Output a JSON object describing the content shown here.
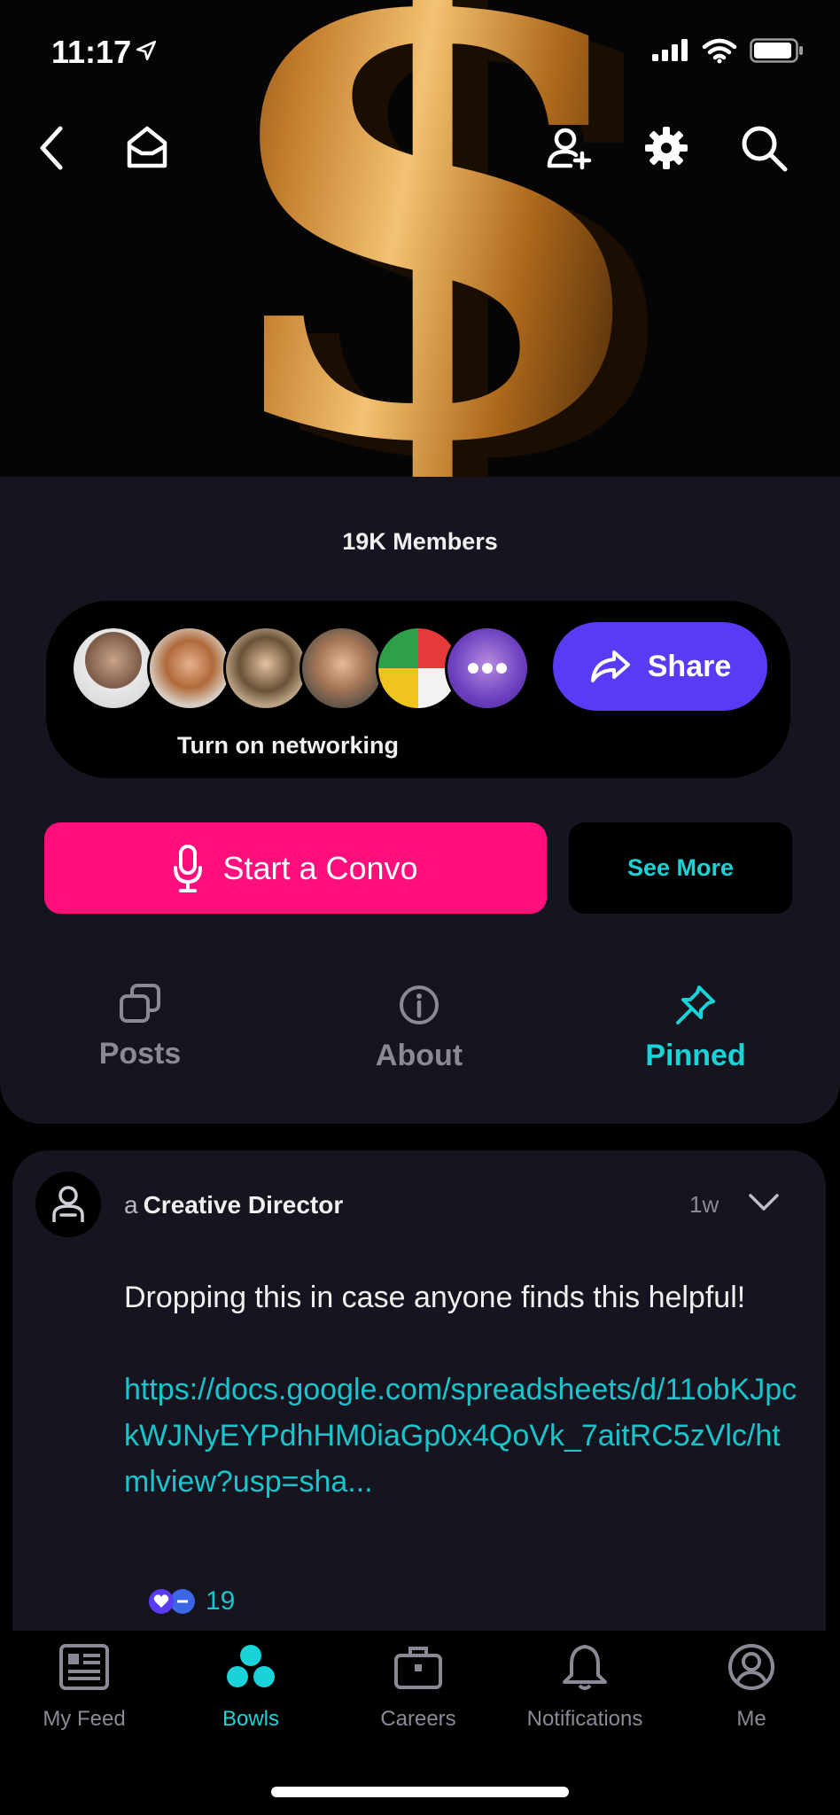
{
  "status_bar": {
    "time": "11:17"
  },
  "group": {
    "members": "19K Members",
    "networking_label": "Turn on networking",
    "share_label": "Share",
    "start_convo_label": "Start a Convo",
    "see_more_label": "See More"
  },
  "tabs": [
    {
      "label": "Posts",
      "icon": "copy-icon",
      "active": false
    },
    {
      "label": "About",
      "icon": "info-icon",
      "active": false
    },
    {
      "label": "Pinned",
      "icon": "pin-icon",
      "active": true
    }
  ],
  "post": {
    "author_prefix": "a",
    "author_role": "Creative Director",
    "time": "1w",
    "text": "Dropping this in case anyone finds this helpful!",
    "link": "https://docs.google.com/spreadsheets/d/11obKJpckWJNyEYPdhHM0iaGp0x4QoVk_7aitRC5zVlc/htmlview?usp=sha...",
    "reaction_count": "19"
  },
  "bottom_nav": [
    {
      "label": "My Feed",
      "icon": "feed-icon",
      "active": false
    },
    {
      "label": "Bowls",
      "icon": "bowls-icon",
      "active": true
    },
    {
      "label": "Careers",
      "icon": "briefcase-icon",
      "active": false
    },
    {
      "label": "Notifications",
      "icon": "bell-icon",
      "active": false
    },
    {
      "label": "Me",
      "icon": "profile-icon",
      "active": false
    }
  ],
  "colors": {
    "accent_cyan": "#19d3d8",
    "share_purple": "#5a3af5",
    "convo_pink": "#ff0f7b",
    "card_bg": "#15141f"
  }
}
